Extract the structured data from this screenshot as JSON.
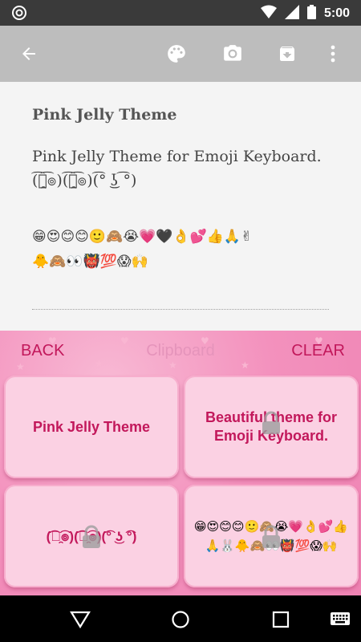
{
  "status_bar": {
    "time": "5:00",
    "icons": [
      "sync-icon",
      "wifi-icon",
      "signal-icon",
      "battery-icon"
    ]
  },
  "toolbar": {
    "icons": [
      "back-arrow-icon",
      "palette-icon",
      "camera-icon",
      "archive-icon",
      "more-vert-icon"
    ]
  },
  "note": {
    "title": "Pink Jelly Theme",
    "body": "Pink Jelly Theme for Emoji Keyboard.",
    "kaomoji": "(͡๏̯͡๏)(͡๏̯͡๏)(͡° ͜ʖ ͡°)",
    "emoji_line1": "😁😍😊😊🙂🙈😭💗🖤👌💕👍🙏✌",
    "emoji_line2": "🐥🙈👀👹💯😱🙌"
  },
  "keyboard": {
    "back_label": "BACK",
    "title": "Clipboard",
    "clear_label": "CLEAR",
    "accent_color": "#c2185b",
    "clips": [
      {
        "text": "Pink Jelly Theme",
        "locked": false
      },
      {
        "text": "Beautiful theme for Emoji Keyboard.",
        "locked": true
      },
      {
        "text": "(͡๏̯͡๏)(͡๏̯͡๏)(͡° ͜ʖ ͡°)",
        "locked": true
      },
      {
        "text": "😁😍😊😊🙂🙈😭💗👌💕👍🙏🐰🐥🙈👀👹💯😱🙌",
        "locked": true
      }
    ]
  },
  "navbar": {
    "icons": [
      "nav-back-icon",
      "nav-home-icon",
      "nav-recents-icon",
      "keyboard-icon"
    ]
  }
}
